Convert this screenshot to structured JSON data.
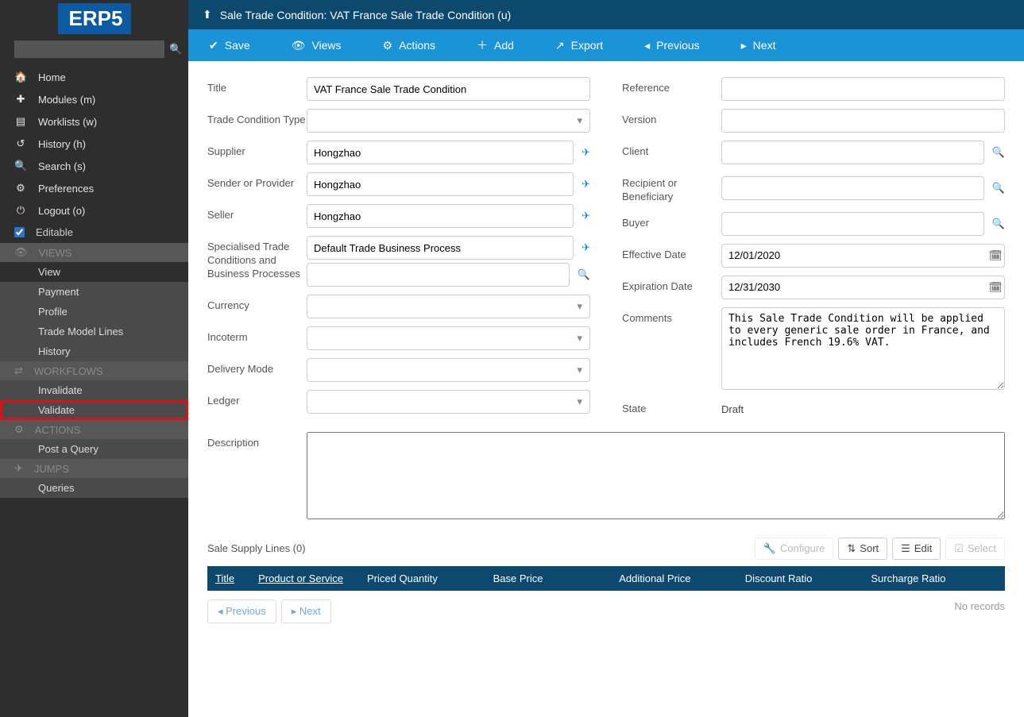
{
  "logo": "ERP5",
  "nav": {
    "home": "Home",
    "modules": "Modules (m)",
    "worklists": "Worklists (w)",
    "history": "History (h)",
    "search": "Search (s)",
    "preferences": "Preferences",
    "logout": "Logout (o)",
    "editable": "Editable"
  },
  "groups": {
    "views": {
      "hdr": "VIEWS",
      "items": [
        "View",
        "Payment",
        "Profile",
        "Trade Model Lines",
        "History"
      ]
    },
    "workflows": {
      "hdr": "WORKFLOWS",
      "items": [
        "Invalidate",
        "Validate"
      ]
    },
    "actions": {
      "hdr": "ACTIONS",
      "items": [
        "Post a Query"
      ]
    },
    "jumps": {
      "hdr": "JUMPS",
      "items": [
        "Queries"
      ]
    }
  },
  "breadcrumb": "Sale Trade Condition: VAT France Sale Trade Condition (u)",
  "toolbar": {
    "save": "Save",
    "views": "Views",
    "actions": "Actions",
    "add": "Add",
    "export": "Export",
    "previous": "Previous",
    "next": "Next"
  },
  "labels": {
    "title": "Title",
    "tctype": "Trade Condition Type",
    "supplier": "Supplier",
    "sender": "Sender or Provider",
    "seller": "Seller",
    "spec": "Specialised Trade Conditions and Business Processes",
    "currency": "Currency",
    "incoterm": "Incoterm",
    "delivery": "Delivery Mode",
    "ledger": "Ledger",
    "reference": "Reference",
    "version": "Version",
    "client": "Client",
    "recipient": "Recipient or Beneficiary",
    "buyer": "Buyer",
    "effdate": "Effective Date",
    "expdate": "Expiration Date",
    "comments": "Comments",
    "state": "State",
    "description": "Description"
  },
  "values": {
    "title": "VAT France Sale Trade Condition",
    "tctype": "",
    "supplier": "Hongzhao",
    "sender": "Hongzhao",
    "seller": "Hongzhao",
    "spec": "Default Trade Business Process",
    "currency": "",
    "incoterm": "",
    "delivery": "",
    "ledger": "",
    "reference": "",
    "version": "",
    "client": "",
    "recipient": "",
    "buyer": "",
    "effdate": "12/01/2020",
    "expdate": "12/31/2030",
    "comments": "This Sale Trade Condition will be applied to every generic sale order in France, and includes French 19.6% VAT.",
    "state": "Draft",
    "description": ""
  },
  "list": {
    "title": "Sale Supply Lines (0)",
    "btn_configure": "Configure",
    "btn_sort": "Sort",
    "btn_edit": "Edit",
    "btn_select": "Select",
    "cols": [
      "Title",
      "Product or Service",
      "Priced Quantity",
      "Base Price",
      "Additional Price",
      "Discount Ratio",
      "Surcharge Ratio"
    ],
    "no_records": "No records",
    "prev": "Previous",
    "next": "Next"
  }
}
